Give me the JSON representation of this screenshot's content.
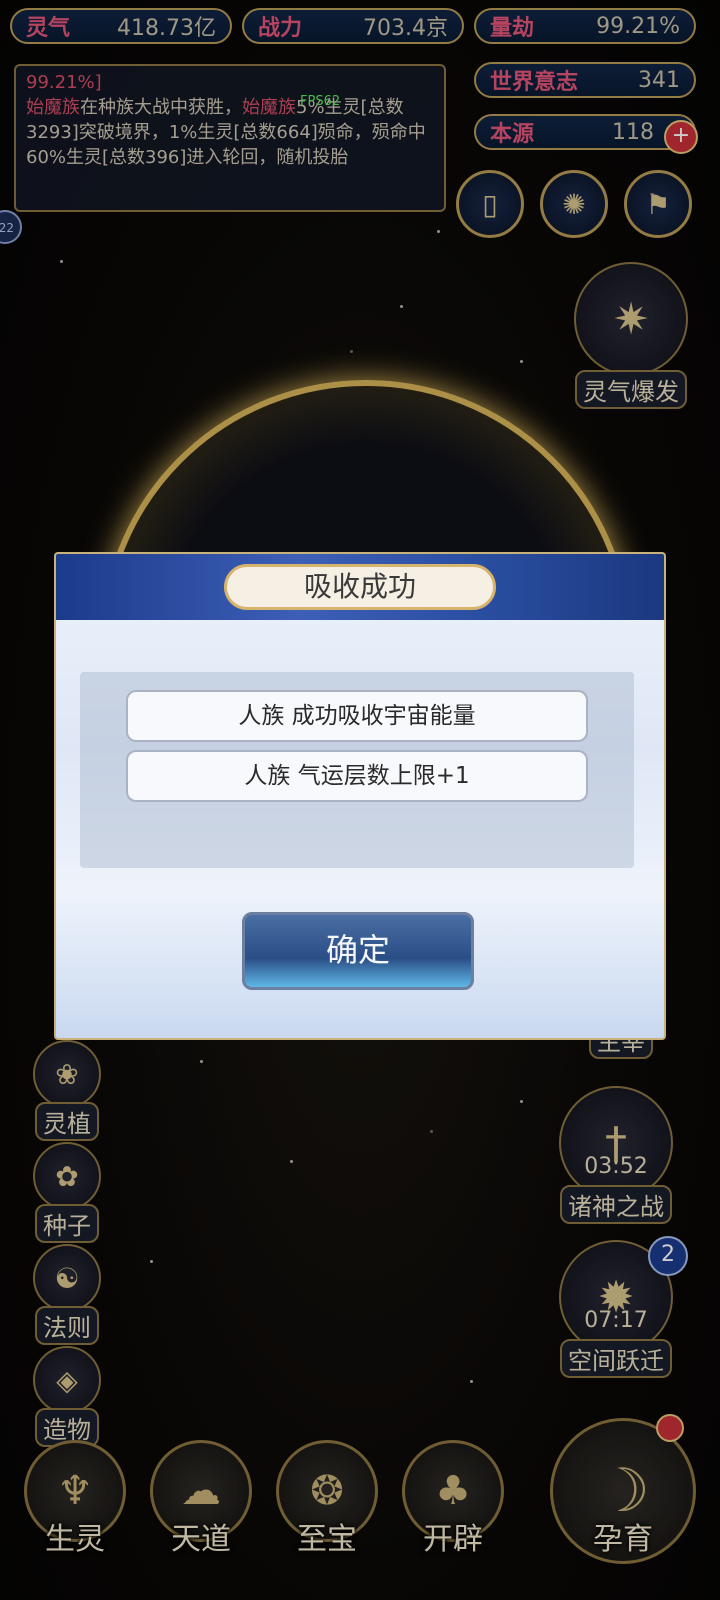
{
  "resources": [
    {
      "label": "灵气",
      "value": "418.73亿"
    },
    {
      "label": "战力",
      "value": "703.4京"
    },
    {
      "label": "量劫",
      "value": "99.21%"
    },
    {
      "label": "世界意志",
      "value": "341"
    },
    {
      "label": "本源",
      "value": "118"
    }
  ],
  "log": {
    "pct": "99.21%]",
    "race1": "始魔族",
    "text1": "在种族大战中获胜，",
    "race2": "始魔族",
    "text2": "5%生灵[总数3293]突破境界，1%生灵[总数664]殒命，殒命中60%生灵[总数396]进入轮回，随机投胎"
  },
  "fps": "FPS62",
  "left_badge": "22",
  "right_buttons": {
    "burst": "灵气爆发",
    "lord": "主宰",
    "war_timer": "03:52",
    "war": "诸神之战",
    "jump_timer": "07:17",
    "jump": "空间跃迁",
    "jump_badge": "2"
  },
  "left_buttons": [
    "灵植",
    "种子",
    "法则",
    "造物"
  ],
  "bottom_nav": [
    "生灵",
    "天道",
    "至宝",
    "开辟",
    "孕育"
  ],
  "modal": {
    "title": "吸收成功",
    "messages": [
      "人族 成功吸收宇宙能量",
      "人族 气运层数上限+1"
    ],
    "confirm": "确定"
  }
}
